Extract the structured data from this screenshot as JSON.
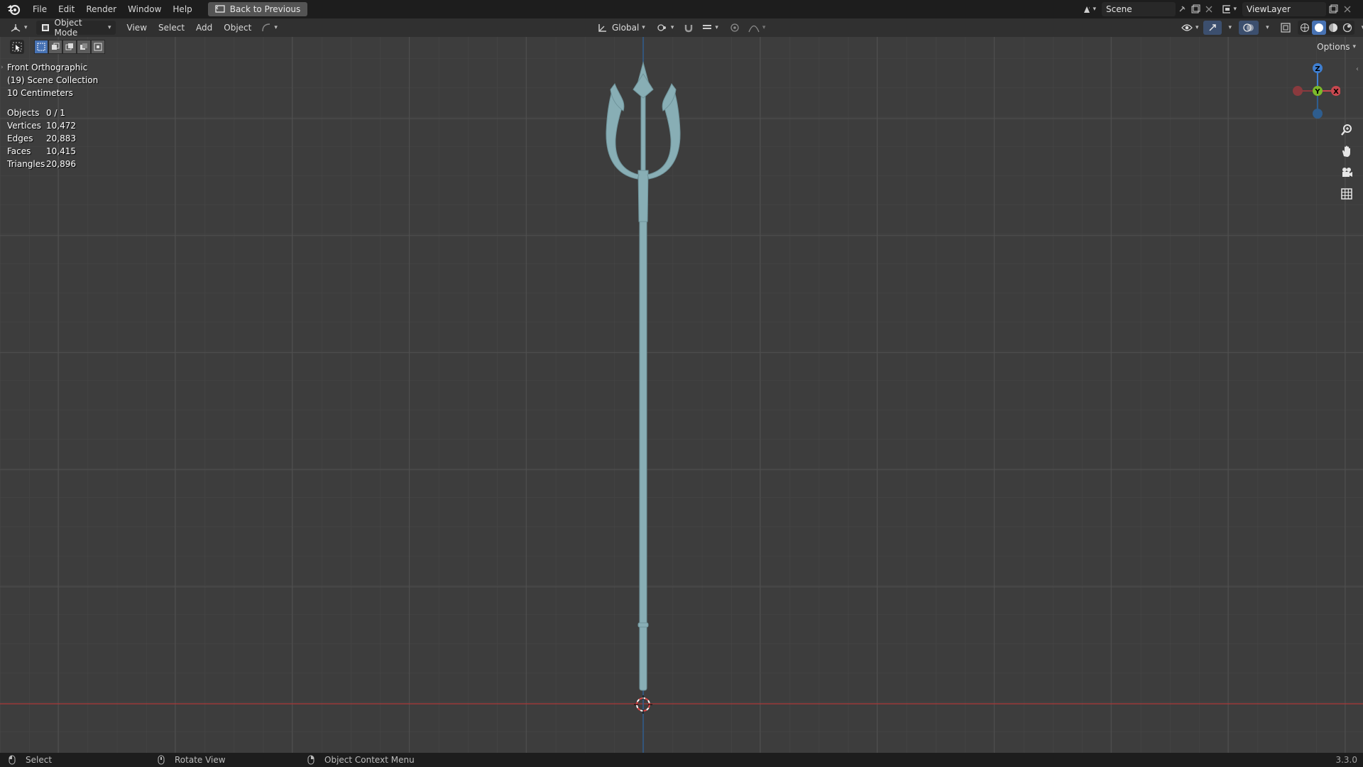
{
  "topbar": {
    "menus": [
      "File",
      "Edit",
      "Render",
      "Window",
      "Help"
    ],
    "back_label": "Back to Previous",
    "scene_name": "Scene",
    "view_layer": "ViewLayer"
  },
  "header": {
    "mode": "Object Mode",
    "menus": [
      "View",
      "Select",
      "Add",
      "Object"
    ],
    "orientation": "Global",
    "options_label": "Options"
  },
  "overlay": {
    "view_name": "Front Orthographic",
    "collection": "(19) Scene Collection",
    "scale": "10 Centimeters"
  },
  "stats": [
    {
      "label": "Objects",
      "value": "0 / 1"
    },
    {
      "label": "Vertices",
      "value": "10,472"
    },
    {
      "label": "Edges",
      "value": "20,883"
    },
    {
      "label": "Faces",
      "value": "10,415"
    },
    {
      "label": "Triangles",
      "value": "20,896"
    }
  ],
  "gizmo": {
    "z_label": "Z",
    "y_label": "Y",
    "x_label": "X"
  },
  "statusbar": {
    "select": "Select",
    "rotate": "Rotate View",
    "context": "Object Context Menu",
    "version": "3.3.0"
  },
  "colors": {
    "trident": "#88aeb5",
    "x_axis": "#c8484f",
    "y_axis": "#7cba2a",
    "z_axis": "#3f7fd1",
    "accent": "#4772b3"
  }
}
